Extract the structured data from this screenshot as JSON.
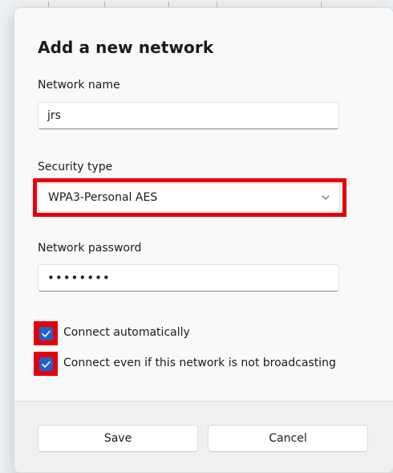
{
  "dialog": {
    "title": "Add a new network",
    "network_name": {
      "label": "Network name",
      "value": "jrs"
    },
    "security_type": {
      "label": "Security type",
      "value": "WPA3-Personal AES",
      "icon": "chevron-down-icon"
    },
    "network_password": {
      "label": "Network password",
      "value": "••••••••"
    },
    "options": [
      {
        "label": "Connect automatically",
        "checked": true
      },
      {
        "label": "Connect even if this network is not broadcasting",
        "checked": true
      }
    ],
    "buttons": {
      "save": "Save",
      "cancel": "Cancel"
    }
  },
  "colors": {
    "accent": "#1f62c6",
    "highlight": "#e6000d",
    "dialog_bg": "#f9f9f9",
    "footer_bg": "#f0f0f0"
  }
}
